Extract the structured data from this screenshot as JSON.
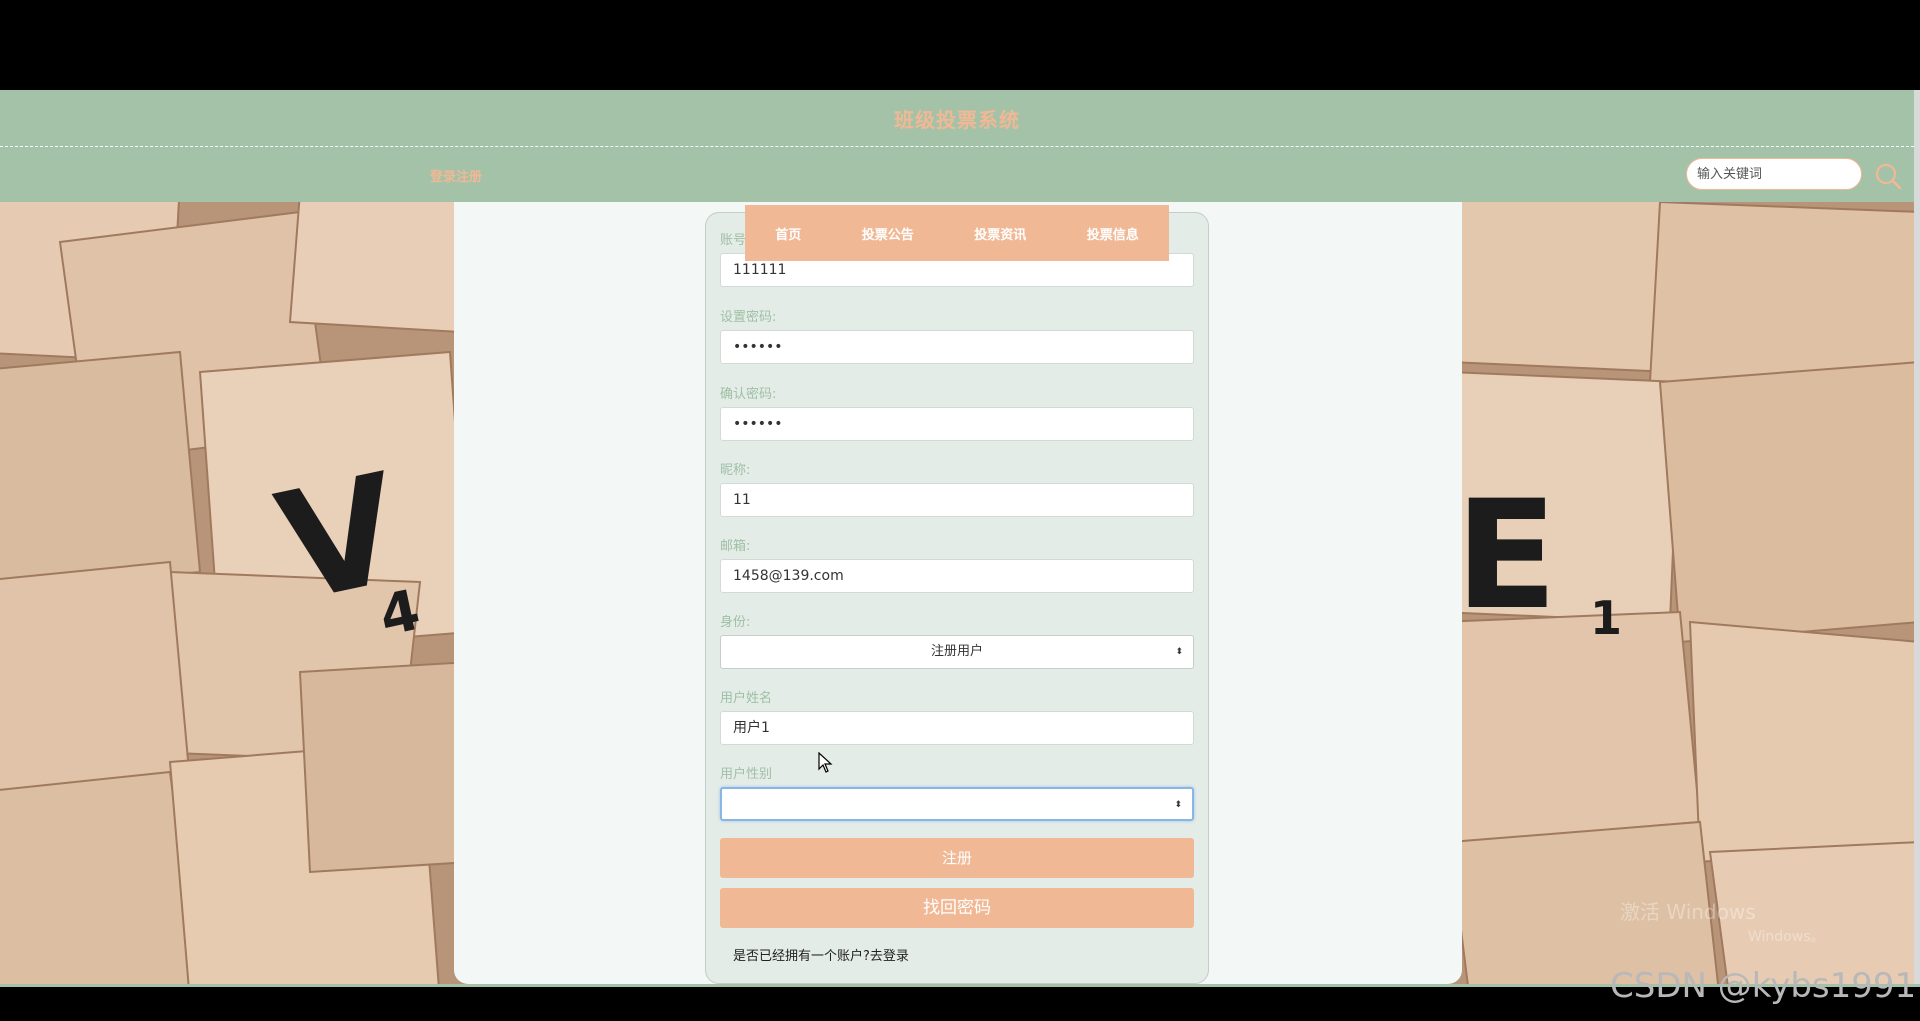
{
  "header": {
    "site_title": "班级投票系统",
    "login_register": "登录注册",
    "search_placeholder": "输入关键词"
  },
  "nav": {
    "items": [
      "首页",
      "投票公告",
      "投票资讯",
      "投票信息"
    ]
  },
  "form": {
    "account_label": "账号:",
    "account_value": "111111",
    "password_label": "设置密码:",
    "password_value": "••••••",
    "confirm_label": "确认密码:",
    "confirm_value": "••••••",
    "nickname_label": "昵称:",
    "nickname_value": "11",
    "email_label": "邮箱:",
    "email_value": "1458@139.com",
    "role_label": "身份:",
    "role_value": "注册用户",
    "username_label": "用户姓名",
    "username_value": "用户1",
    "gender_label": "用户性别",
    "gender_value": "",
    "register_button": "注册",
    "find_password_button": "找回密码",
    "login_prompt": "是否已经拥有一个账户?去登录"
  },
  "overlay": {
    "watermark": "CSDN @kybs1991",
    "activate_windows": "激活 Windows",
    "activate_windows_sub": "Windows。"
  },
  "colors": {
    "header_bg": "#a3c2a8",
    "accent": "#f1b895",
    "panel_bg": "#f3f7f5",
    "card_bg": "#e4ece7"
  }
}
